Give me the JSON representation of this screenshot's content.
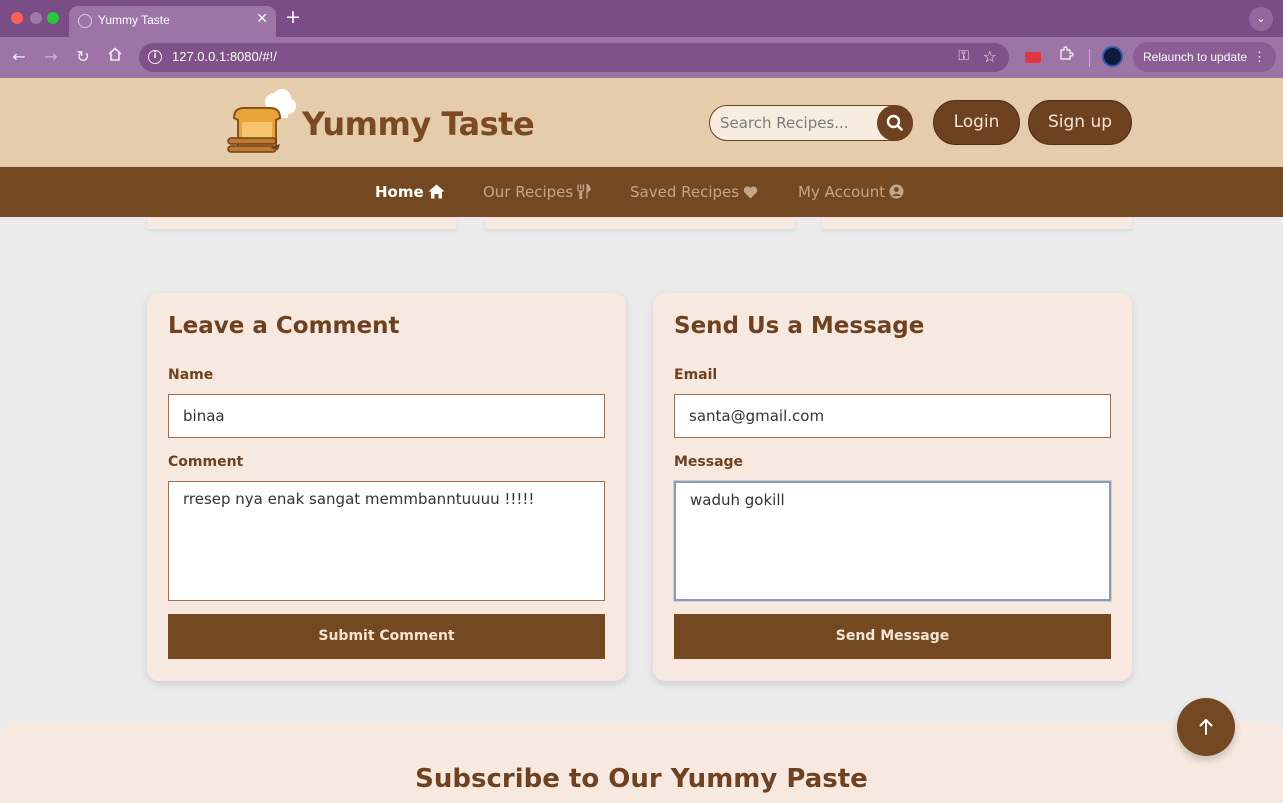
{
  "browser": {
    "tab_title": "Yummy Taste",
    "tab_close": "✕",
    "new_tab": "+",
    "url": "127.0.0.1:8080/#!/",
    "relaunch_label": "Relaunch to update"
  },
  "header": {
    "brand": "Yummy Taste",
    "search_placeholder": "Search Recipes...",
    "login_label": "Login",
    "signup_label": "Sign up"
  },
  "nav": {
    "items": [
      {
        "label": "Home",
        "icon": "home-icon"
      },
      {
        "label": "Our Recipes",
        "icon": "utensils-icon"
      },
      {
        "label": "Saved Recipes",
        "icon": "heart-icon"
      },
      {
        "label": "My Account",
        "icon": "user-circle-icon"
      }
    ]
  },
  "comment_form": {
    "title": "Leave a Comment",
    "name_label": "Name",
    "name_value": "binaa",
    "comment_label": "Comment",
    "comment_value": "rresep nya enak sangat memmbanntuuuu !!!!!",
    "submit_label": "Submit Comment"
  },
  "message_form": {
    "title": "Send Us a Message",
    "email_label": "Email",
    "email_value": "santa@gmail.com",
    "message_label": "Message",
    "message_value": "waduh gokill",
    "submit_label": "Send Message"
  },
  "subscribe": {
    "title": "Subscribe to Our Yummy Paste"
  },
  "colors": {
    "brand_brown": "#744922",
    "header_tan": "#e5ccab",
    "panel_bg": "#f7e9df",
    "browser_purple": "#9c74a6"
  }
}
